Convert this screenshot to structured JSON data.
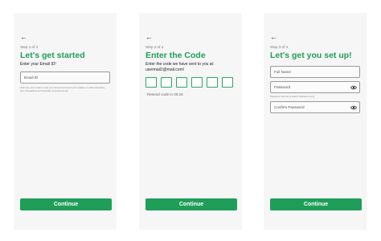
{
  "screens": [
    {
      "back_icon": "←",
      "step": "Step 1 of 4",
      "title": "Let's get started",
      "subtitle": "Enter your Email ID!",
      "fields": [
        {
          "placeholder": "Email ID"
        }
      ],
      "hint": "We'll use your email to verify your account and send you updates on order schedules, price fluctuations and important announcements.",
      "button": "Continue"
    },
    {
      "back_icon": "←",
      "step": "Step 2 of 4",
      "title": "Enter the Code",
      "subtitle": "Enter the code we have sent to you at: usermail1@mail.com!",
      "otp_digits": [
        "",
        "",
        "",
        "",
        "",
        ""
      ],
      "resend": "Resend code in 00:16",
      "button": "Continue"
    },
    {
      "back_icon": "←",
      "step": "Step 3 of 4",
      "title": "Let's get you set up!",
      "fields": [
        {
          "placeholder": "Full Name"
        },
        {
          "placeholder": "Password",
          "icon": "eye-icon"
        },
        {
          "placeholder": "Confirm Password",
          "icon": "eye-icon"
        }
      ],
      "password_hint": "Password must be at least 8 characters long.",
      "button": "Continue"
    }
  ],
  "colors": {
    "accent": "#1e9e57",
    "button": "#1f9e5a",
    "otp_border": "#2aa86a",
    "screen_bg": "#f6f6f6"
  }
}
